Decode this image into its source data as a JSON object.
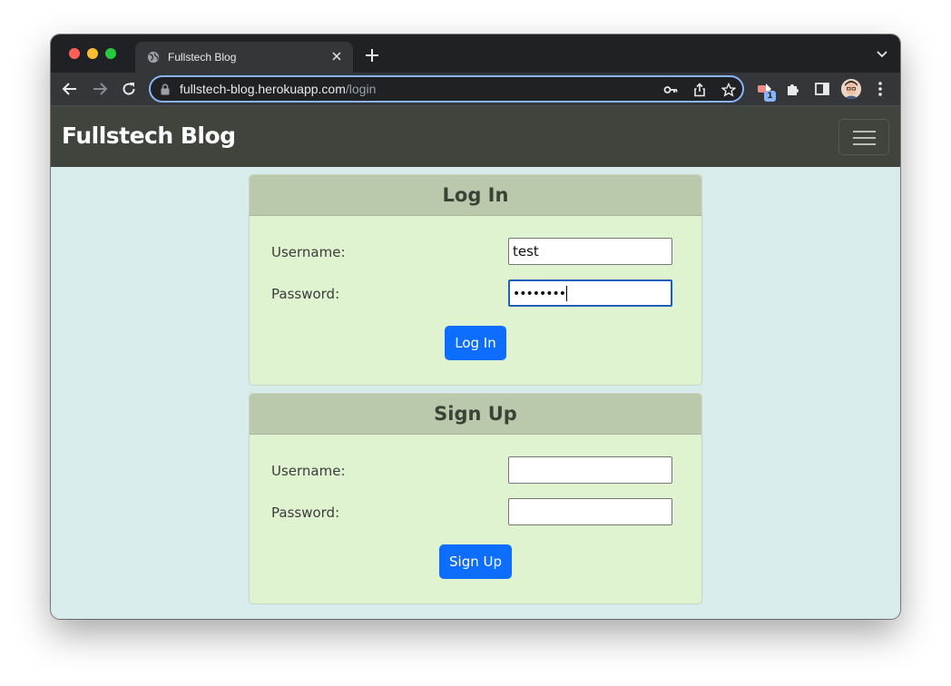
{
  "browser": {
    "tab_title": "Fullstech Blog",
    "url_host": "fullstech-blog.herokuapp.com",
    "url_path": "/login",
    "extension_badge": "1"
  },
  "site": {
    "brand": "Fullstech Blog"
  },
  "login": {
    "title": "Log In",
    "username_label": "Username:",
    "username_value": "test",
    "password_label": "Password:",
    "password_value": "••••••••",
    "submit_label": "Log In"
  },
  "signup": {
    "title": "Sign Up",
    "username_label": "Username:",
    "username_value": "",
    "password_label": "Password:",
    "password_value": "",
    "submit_label": "Sign Up"
  },
  "colors": {
    "navbar": "#3f453c",
    "page_bg": "#d9ecec",
    "card_bg": "#e0f3d0",
    "card_header": "#bac9ac",
    "primary_button": "#0d6efd"
  },
  "icons": [
    "globe-icon",
    "close-icon",
    "plus-icon",
    "chevron-down-icon",
    "back-arrow-icon",
    "forward-arrow-icon",
    "reload-icon",
    "lock-icon",
    "key-icon",
    "share-icon",
    "star-icon",
    "extension-icon",
    "puzzle-icon",
    "sidebar-icon",
    "avatar",
    "more-vert-icon",
    "hamburger-icon"
  ]
}
